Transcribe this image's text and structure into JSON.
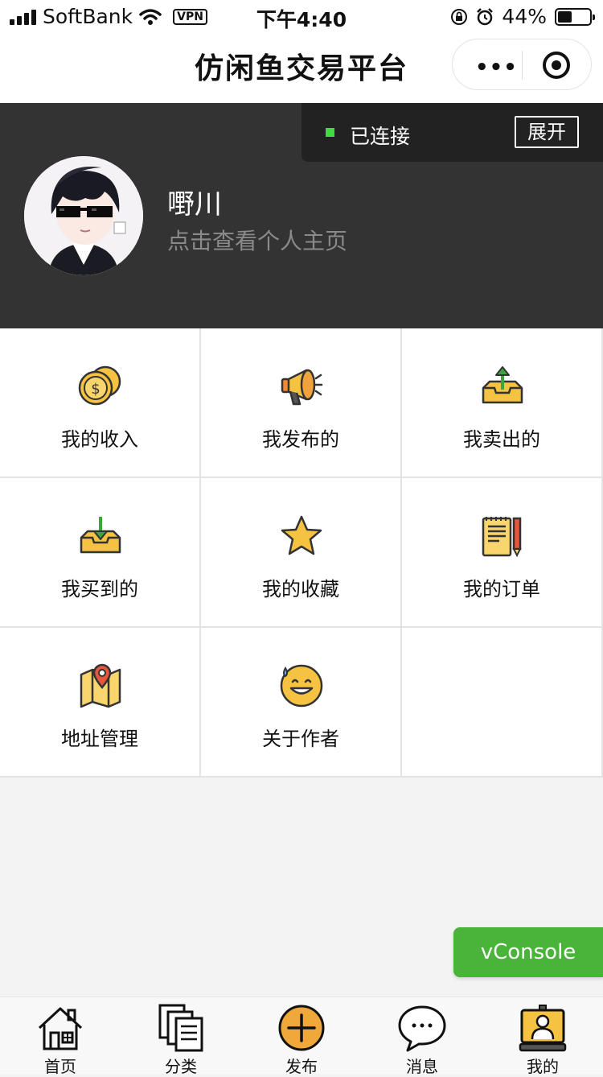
{
  "status_bar": {
    "carrier": "SoftBank",
    "vpn": "VPN",
    "time": "下午4:40",
    "battery": "44%",
    "battery_level": 0.44
  },
  "nav": {
    "title": "仿闲鱼交易平台",
    "more": "•••"
  },
  "connection": {
    "status": "已连接",
    "expand": "展开"
  },
  "profile": {
    "name": "嘢川",
    "hint": "点击查看个人主页"
  },
  "menu": [
    {
      "label": "我的收入",
      "icon": "coins-icon"
    },
    {
      "label": "我发布的",
      "icon": "megaphone-icon"
    },
    {
      "label": "我卖出的",
      "icon": "tray-upload-icon"
    },
    {
      "label": "我买到的",
      "icon": "tray-download-icon"
    },
    {
      "label": "我的收藏",
      "icon": "star-icon"
    },
    {
      "label": "我的订单",
      "icon": "notepad-icon"
    },
    {
      "label": "地址管理",
      "icon": "map-pin-icon"
    },
    {
      "label": "关于作者",
      "icon": "sweat-smile-icon"
    }
  ],
  "vconsole": "vConsole",
  "tabbar": [
    {
      "label": "首页",
      "icon": "home-icon"
    },
    {
      "label": "分类",
      "icon": "category-icon"
    },
    {
      "label": "发布",
      "icon": "publish-plus-icon"
    },
    {
      "label": "消息",
      "icon": "message-bubble-icon"
    },
    {
      "label": "我的",
      "icon": "profile-card-icon"
    }
  ],
  "colors": {
    "header_bg": "#333333",
    "accent_yellow": "#f5c242",
    "vconsole_green": "#4ab33a",
    "connected_green": "#3fdc3f"
  }
}
